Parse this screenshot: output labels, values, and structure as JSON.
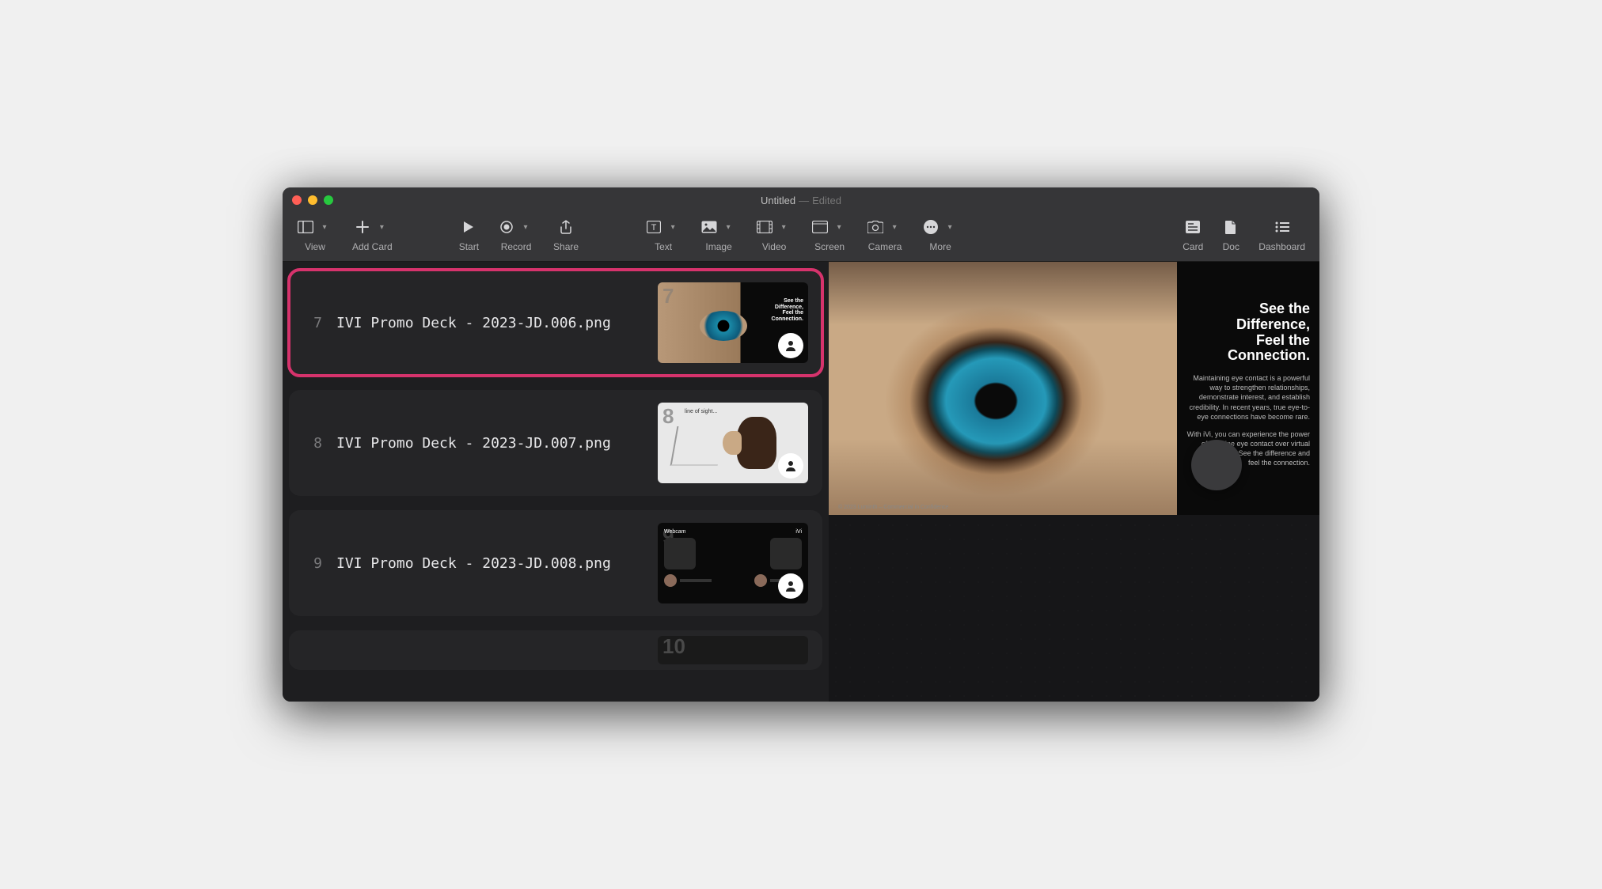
{
  "window": {
    "title": "Untitled",
    "separator": "—",
    "status": "Edited"
  },
  "toolbar": {
    "view": "View",
    "add_card": "Add Card",
    "start": "Start",
    "record": "Record",
    "share": "Share",
    "text": "Text",
    "image": "Image",
    "video": "Video",
    "screen": "Screen",
    "camera": "Camera",
    "more": "More",
    "card": "Card",
    "doc": "Doc",
    "dashboard": "Dashboard"
  },
  "cards": [
    {
      "index": "7",
      "title": "IVI Promo Deck - 2023-JD.006.png",
      "selected": true,
      "thumb": "eye",
      "big": "7"
    },
    {
      "index": "8",
      "title": "IVI Promo Deck - 2023-JD.007.png",
      "selected": false,
      "thumb": "woman",
      "big": "8",
      "line": "line of sight..."
    },
    {
      "index": "9",
      "title": "IVI Promo Deck - 2023-JD.008.png",
      "selected": false,
      "thumb": "compare",
      "big": "9",
      "left_label": "Webcam",
      "right_label": "iVi"
    },
    {
      "index": "10",
      "title": "",
      "selected": false,
      "thumb": "blank",
      "big": "10"
    }
  ],
  "preview": {
    "heading_l1": "See the",
    "heading_l2": "Difference,",
    "heading_l3": "Feel the",
    "heading_l4": "Connection.",
    "para1": "Maintaining eye contact is a powerful way to strengthen relationships, demonstrate interest, and establish credibility. In recent years, true eye-to-eye connections have become rare.",
    "para2": "With iVi, you can experience the power of genuine eye contact over virtual interactions. See the difference and feel the connection.",
    "footer": "© 2023 Luminth – Commercial in Confidence"
  },
  "icons": {
    "person": "person"
  }
}
